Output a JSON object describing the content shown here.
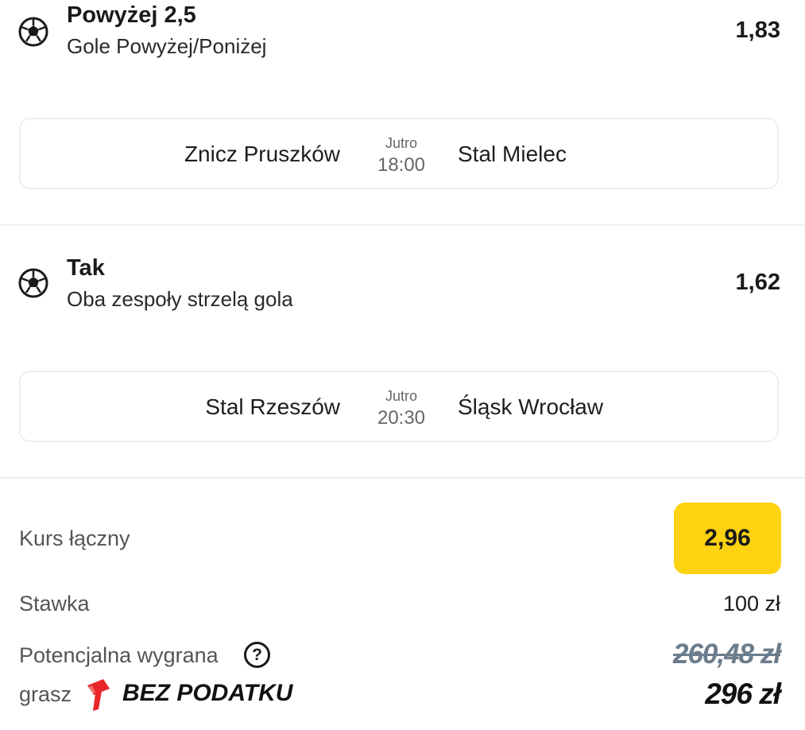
{
  "bets": [
    {
      "pick": "Powyżej 2,5",
      "market": "Gole Powyżej/Poniżej",
      "odd": "1,83",
      "match": {
        "home": "Znicz Pruszków",
        "away": "Stal Mielec",
        "day": "Jutro",
        "time": "18:00"
      }
    },
    {
      "pick": "Tak",
      "market": "Oba zespoły strzelą gola",
      "odd": "1,62",
      "match": {
        "home": "Stal Rzeszów",
        "away": "Śląsk Wrocław",
        "day": "Jutro",
        "time": "20:30"
      }
    }
  ],
  "summary": {
    "total_odds_label": "Kurs łączny",
    "total_odds": "2,96",
    "stake_label": "Stawka",
    "stake": "100 zł",
    "potential_win_label": "Potencjalna wygrana",
    "help_symbol": "?",
    "old_win": "260,48 zł",
    "new_win": "296 zł",
    "promo_prefix": "grasz",
    "promo_text": "BEZ PODATKU"
  },
  "colors": {
    "accent": "#fdd210",
    "promo_red": "#e8262a"
  },
  "icons": {
    "sport": "soccer-ball-icon",
    "help": "help-icon",
    "promo": "hammer-icon"
  }
}
